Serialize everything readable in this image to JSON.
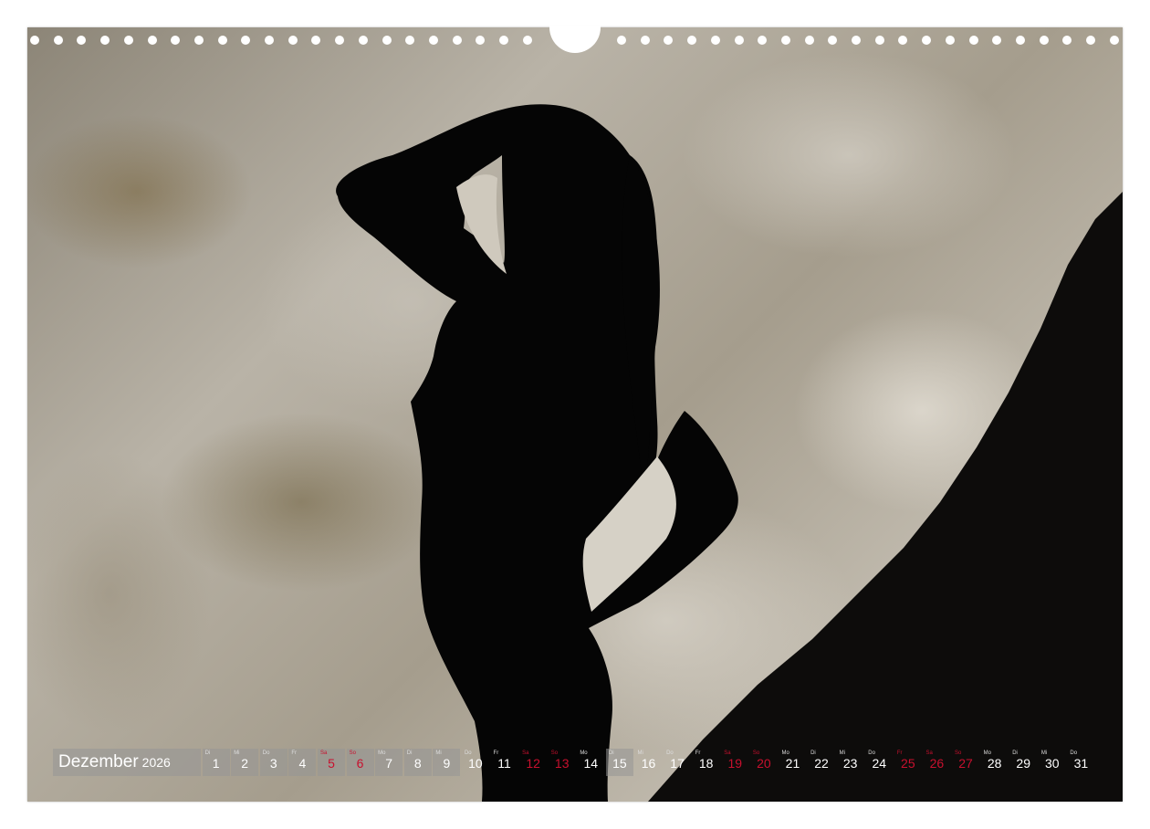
{
  "calendar": {
    "month": "Dezember",
    "year": "2026",
    "accent_color": "#c8102e",
    "days": [
      {
        "dow": "Di",
        "num": "1",
        "weekend": false
      },
      {
        "dow": "Mi",
        "num": "2",
        "weekend": false
      },
      {
        "dow": "Do",
        "num": "3",
        "weekend": false
      },
      {
        "dow": "Fr",
        "num": "4",
        "weekend": false
      },
      {
        "dow": "Sa",
        "num": "5",
        "weekend": true
      },
      {
        "dow": "So",
        "num": "6",
        "weekend": true
      },
      {
        "dow": "Mo",
        "num": "7",
        "weekend": false
      },
      {
        "dow": "Di",
        "num": "8",
        "weekend": false
      },
      {
        "dow": "Mi",
        "num": "9",
        "weekend": false
      },
      {
        "dow": "Do",
        "num": "10",
        "weekend": false
      },
      {
        "dow": "Fr",
        "num": "11",
        "weekend": false
      },
      {
        "dow": "Sa",
        "num": "12",
        "weekend": true
      },
      {
        "dow": "So",
        "num": "13",
        "weekend": true
      },
      {
        "dow": "Mo",
        "num": "14",
        "weekend": false
      },
      {
        "dow": "Di",
        "num": "15",
        "weekend": false
      },
      {
        "dow": "Mi",
        "num": "16",
        "weekend": false
      },
      {
        "dow": "Do",
        "num": "17",
        "weekend": false
      },
      {
        "dow": "Fr",
        "num": "18",
        "weekend": false
      },
      {
        "dow": "Sa",
        "num": "19",
        "weekend": true
      },
      {
        "dow": "So",
        "num": "20",
        "weekend": true
      },
      {
        "dow": "Mo",
        "num": "21",
        "weekend": false
      },
      {
        "dow": "Di",
        "num": "22",
        "weekend": false
      },
      {
        "dow": "Mi",
        "num": "23",
        "weekend": false
      },
      {
        "dow": "Do",
        "num": "24",
        "weekend": false
      },
      {
        "dow": "Fr",
        "num": "25",
        "weekend": true
      },
      {
        "dow": "Sa",
        "num": "26",
        "weekend": true
      },
      {
        "dow": "So",
        "num": "27",
        "weekend": true
      },
      {
        "dow": "Mo",
        "num": "28",
        "weekend": false
      },
      {
        "dow": "Di",
        "num": "29",
        "weekend": false
      },
      {
        "dow": "Mi",
        "num": "30",
        "weekend": false
      },
      {
        "dow": "Do",
        "num": "31",
        "weekend": false
      }
    ]
  },
  "binding": {
    "hole_count_left": 22,
    "hole_count_right": 22
  }
}
